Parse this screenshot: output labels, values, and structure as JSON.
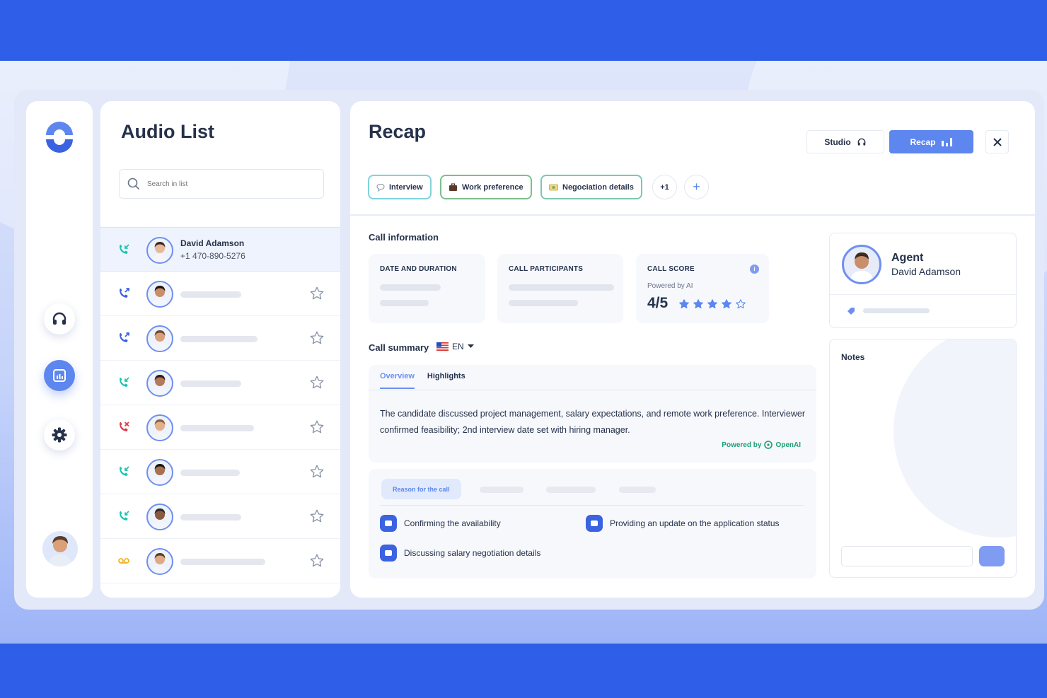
{
  "nav": {
    "items": [
      {
        "name": "headphones-icon",
        "active": false
      },
      {
        "name": "chart-icon",
        "active": true
      },
      {
        "name": "gear-icon",
        "active": false
      }
    ]
  },
  "audio_list": {
    "title": "Audio List",
    "search_placeholder": "Search in list",
    "rows": [
      {
        "call_type": "incoming",
        "call_color": "#19c6b3",
        "name": "David Adamson",
        "phone": "+1 470-890-5276",
        "selected": true
      },
      {
        "call_type": "outgoing",
        "call_color": "#3b62e0",
        "placeholder_fraction": 0.52
      },
      {
        "call_type": "outgoing",
        "call_color": "#3b62e0",
        "placeholder_fraction": 0.66
      },
      {
        "call_type": "incoming",
        "call_color": "#19c6b3",
        "placeholder_fraction": 0.52
      },
      {
        "call_type": "missed",
        "call_color": "#e2384a",
        "placeholder_fraction": 0.63
      },
      {
        "call_type": "incoming",
        "call_color": "#19c6b3",
        "placeholder_fraction": 0.51
      },
      {
        "call_type": "incoming",
        "call_color": "#19c6b3",
        "placeholder_fraction": 0.52
      },
      {
        "call_type": "voicemail",
        "call_color": "#f0b429",
        "placeholder_fraction": 0.73
      }
    ]
  },
  "recap": {
    "title": "Recap",
    "studio_label": "Studio",
    "recap_label": "Recap",
    "tags": [
      {
        "label": "Interview",
        "icon": "speech-bubble-icon",
        "color": "#7fd3dc"
      },
      {
        "label": "Work preference",
        "icon": "briefcase-icon",
        "color": "#7cc08e"
      },
      {
        "label": "Negociation details",
        "icon": "money-icon",
        "color": "#7cc8b2"
      }
    ],
    "more_tags": "+1",
    "add_tag": "+"
  },
  "call_information": {
    "title": "Call information",
    "date_duration_label": "DATE AND DURATION",
    "participants_label": "CALL PARTICIPANTS",
    "score_label": "CALL SCORE",
    "powered_by_ai": "Powered by AI",
    "score": "4/5",
    "rating": 4,
    "rating_max": 5
  },
  "call_summary": {
    "title": "Call summary",
    "language": "EN",
    "tabs": [
      "Overview",
      "Highlights"
    ],
    "text": "The candidate discussed project management, salary expectations, and remote work preference. Interviewer confirmed feasibility; 2nd interview date set with hiring manager.",
    "powered_by": "Powered by",
    "provider": "OpenAI"
  },
  "reasons": {
    "tab_label": "Reason for the call",
    "items": [
      "Confirming the availability",
      "Providing an update on the application status",
      "Discussing salary negotiation details"
    ]
  },
  "agent": {
    "role": "Agent",
    "name": "David Adamson"
  },
  "notes": {
    "title": "Notes"
  },
  "colors": {
    "brand_blue": "#2f5ee8",
    "accent": "#5d86ef",
    "teal": "#19c6b3",
    "red": "#e2384a",
    "star": "#5d86ef"
  }
}
